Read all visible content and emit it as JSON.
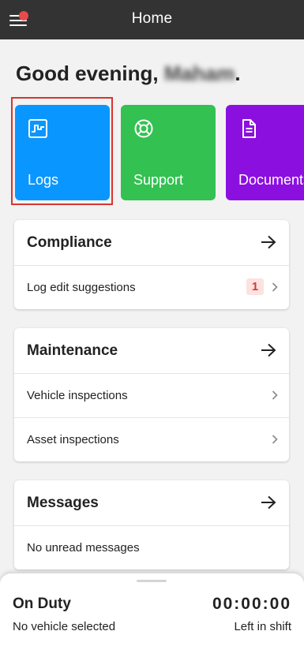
{
  "header": {
    "title": "Home"
  },
  "greeting": {
    "prefix": "Good evening,",
    "name": "Maham",
    "suffix": "."
  },
  "tiles": [
    {
      "label": "Logs",
      "icon": "logs-icon",
      "color": "#0a96ff"
    },
    {
      "label": "Support",
      "icon": "lifebuoy-icon",
      "color": "#33c152"
    },
    {
      "label": "Documents",
      "icon": "document-icon",
      "color": "#8b10e0"
    }
  ],
  "compliance": {
    "title": "Compliance",
    "rows": [
      {
        "label": "Log edit suggestions",
        "badge": "1"
      }
    ]
  },
  "maintenance": {
    "title": "Maintenance",
    "rows": [
      {
        "label": "Vehicle inspections"
      },
      {
        "label": "Asset inspections"
      }
    ]
  },
  "messages": {
    "title": "Messages",
    "rows": [
      {
        "label": "No unread messages"
      }
    ]
  },
  "status_sheet": {
    "status": "On Duty",
    "timer": "00:00:00",
    "vehicle": "No vehicle selected",
    "timer_caption": "Left in shift"
  },
  "colors": {
    "topbar": "#333333",
    "accent_red": "#d9342f",
    "notification_dot": "#e84a4a"
  }
}
